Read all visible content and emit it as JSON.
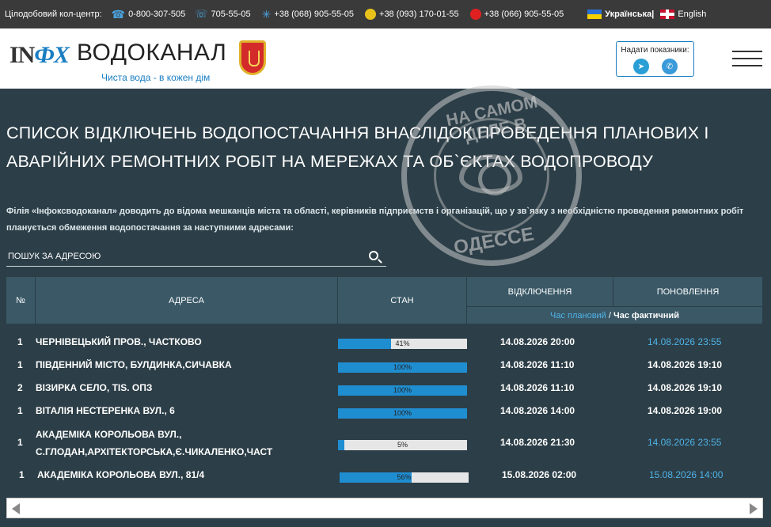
{
  "topbar": {
    "label": "Цілодобовий кол-центр:",
    "phones": [
      {
        "icon": "phone-icon",
        "number": "0-800-307-505"
      },
      {
        "icon": "landline-icon",
        "number": "705-55-05"
      },
      {
        "icon": "kyivstar-icon",
        "number": "+38 (068) 905-55-05"
      },
      {
        "icon": "lifecell-icon",
        "number": "+38 (093) 170-01-55"
      },
      {
        "icon": "vodafone-icon",
        "number": "+38 (066) 905-55-05"
      }
    ],
    "lang_ua": "Українська|",
    "lang_en": "English"
  },
  "header": {
    "logo_in": "IN",
    "logo_fox": "ФХ",
    "logo_main": "ВОДОКАНАЛ",
    "slogan": "Чиста вода - в кожен дім",
    "readings_label": "Надати показники:"
  },
  "content": {
    "title": "СПИСОК ВІДКЛЮЧЕНЬ ВОДОПОСТАЧАННЯ ВНАСЛІДОК ПРОВЕДЕННЯ ПЛАНОВИХ І АВАРІЙНИХ РЕМОНТНИХ РОБІТ НА МЕРЕЖАХ ТА ОБ`ЄКТАХ ВОДОПРОВОДУ",
    "intro": "Філія «Інфоксводоканал» доводить до відома мешканців міста та області, керівників підприємств і організацій, що у зв`язку з необхідністю проведення ремонтних робіт планується обмеження водопостачання за наступними адресами:",
    "search_placeholder": "ПОШУК ЗА АДРЕСОЮ"
  },
  "watermark": {
    "top": "НА САМОМ ДЕЛЕ В",
    "bottom": "ОДЕССЕ"
  },
  "table": {
    "col_num": "№",
    "col_addr": "АДРЕСА",
    "col_state": "СТАН",
    "col_off": "ВІДКЛЮЧЕННЯ",
    "col_upd": "ПОНОВЛЕННЯ",
    "sub_planned": "Час плановий",
    "sub_sep": " / ",
    "sub_actual": "Час фактичний",
    "rows": [
      {
        "num": "1",
        "addr": "ЧЕРНІВЕЦЬКИЙ ПРОВ., ЧАСТКОВО",
        "progress": 41,
        "progress_label": "41%",
        "off": "14.08.2026 20:00",
        "upd": "14.08.2026 23:55",
        "upd_planned": true
      },
      {
        "num": "1",
        "addr": "ПІВДЕННИЙ МІСТО, БУЛДИНКА,СИЧАВКА",
        "progress": 100,
        "progress_label": "100%",
        "off": "14.08.2026 11:10",
        "upd": "14.08.2026 19:10",
        "upd_planned": false
      },
      {
        "num": "2",
        "addr": "ВІЗИРКА СЕЛО, TIS. ОПЗ",
        "progress": 100,
        "progress_label": "100%",
        "off": "14.08.2026 11:10",
        "upd": "14.08.2026 19:10",
        "upd_planned": false
      },
      {
        "num": "1",
        "addr": "ВІТАЛІЯ НЕСТЕРЕНКА ВУЛ., 6",
        "progress": 100,
        "progress_label": "100%",
        "off": "14.08.2026 14:00",
        "upd": "14.08.2026 19:00",
        "upd_planned": false
      },
      {
        "num": "1",
        "addr": "АКАДЕМІКА КОРОЛЬОВА ВУЛ., С.ГЛОДАН,АРХІТЕКТОРСЬКА,Є.ЧИКАЛЕНКО,ЧАСТ",
        "progress": 5,
        "progress_label": "5%",
        "off": "14.08.2026 21:30",
        "upd": "14.08.2026 23:55",
        "upd_planned": true
      },
      {
        "num": "1",
        "addr": "АКАДЕМІКА КОРОЛЬОВА ВУЛ., 81/4",
        "progress": 56,
        "progress_label": "56%",
        "off": "15.08.2026 02:00",
        "upd": "15.08.2026 14:00",
        "upd_planned": true
      }
    ]
  },
  "colors": {
    "background": "#2c3e47",
    "header_cell": "#3a5866",
    "accent_blue": "#1f8ed1",
    "planned_text": "#4fb3e8"
  }
}
